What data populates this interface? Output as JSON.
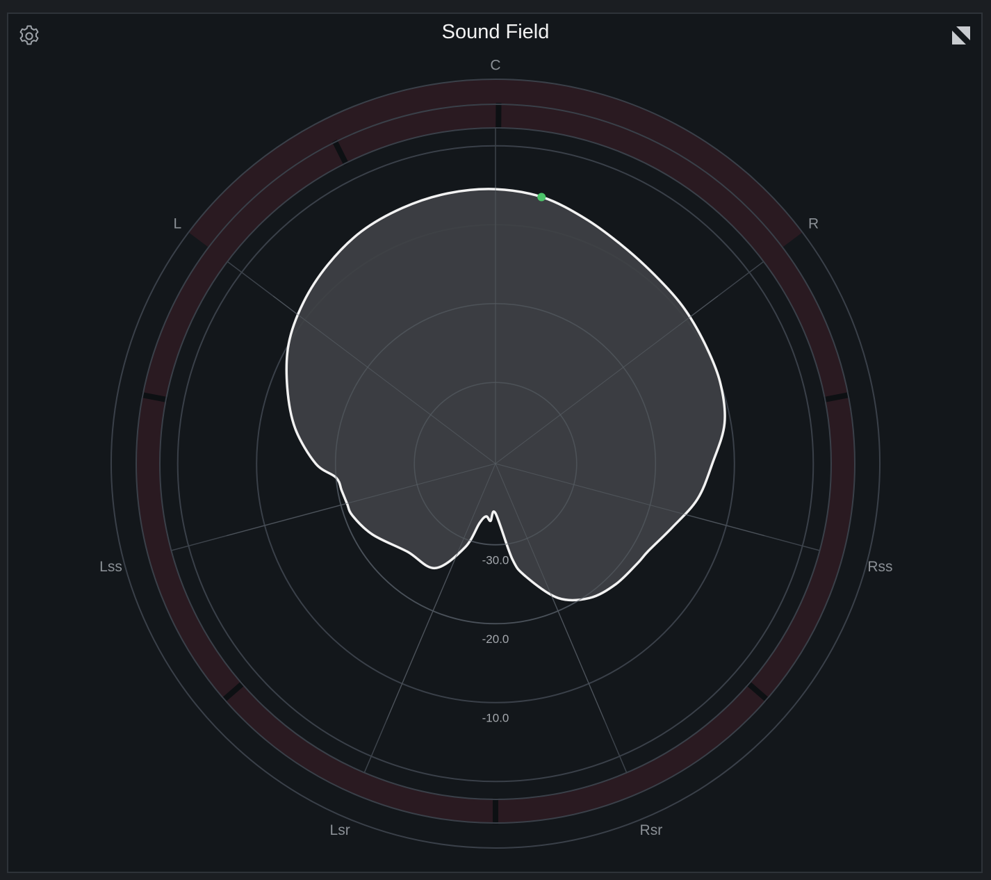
{
  "header": {
    "title": "Sound Field",
    "settings_icon": "gear-icon",
    "expand_icon": "expand-icon"
  },
  "colors": {
    "background": "#13171b",
    "ring": "#3a4049",
    "spoke": "#3d434b",
    "meter_fill": "#2a1a21",
    "meter_gap": "#13171b",
    "lobe_fill": "#3f4145",
    "lobe_stroke": "#f2f2f2",
    "channel_label": "#8b9096",
    "scale_label": "#a4a8ad",
    "indicator": "#4cc46a"
  },
  "channels": [
    {
      "name": "C",
      "angle_deg": 0
    },
    {
      "name": "R",
      "angle_deg": 53
    },
    {
      "name": "Rss",
      "angle_deg": 105
    },
    {
      "name": "Rsr",
      "angle_deg": 157
    },
    {
      "name": "Lsr",
      "angle_deg": 203
    },
    {
      "name": "Lss",
      "angle_deg": 255
    },
    {
      "name": "L",
      "angle_deg": 307
    }
  ],
  "scale": {
    "unit": "dB",
    "rings": [
      {
        "label": "-30.0",
        "value": -30
      },
      {
        "label": "-20.0",
        "value": -20
      },
      {
        "label": "-10.0",
        "value": -10
      }
    ]
  },
  "indicator": {
    "angle_deg": 9.8,
    "level_db": -6
  },
  "lobe": {
    "points": [
      [
        0,
        -5.5
      ],
      [
        10,
        -6.0
      ],
      [
        20,
        -7.2
      ],
      [
        30,
        -8.3
      ],
      [
        40,
        -9.0
      ],
      [
        50,
        -9.3
      ],
      [
        60,
        -9.7
      ],
      [
        70,
        -10.0
      ],
      [
        80,
        -10.8
      ],
      [
        90,
        -12.8
      ],
      [
        100,
        -14.3
      ],
      [
        110,
        -16.5
      ],
      [
        120,
        -18.0
      ],
      [
        125,
        -18.3
      ],
      [
        135,
        -18.7
      ],
      [
        145,
        -19.5
      ],
      [
        155,
        -21.5
      ],
      [
        165,
        -25.5
      ],
      [
        170,
        -28.0
      ],
      [
        180,
        -34.0
      ],
      [
        185,
        -33.0
      ],
      [
        190,
        -33.5
      ],
      [
        195,
        -32.5
      ],
      [
        200,
        -29.0
      ],
      [
        210,
        -25.0
      ],
      [
        225,
        -24.5
      ],
      [
        240,
        -22.3
      ],
      [
        250,
        -21.0
      ],
      [
        255,
        -20.8
      ],
      [
        260,
        -20.5
      ],
      [
        265,
        -20.0
      ],
      [
        270,
        -17.5
      ],
      [
        280,
        -14.5
      ],
      [
        290,
        -12.2
      ],
      [
        300,
        -10.0
      ],
      [
        310,
        -8.5
      ],
      [
        320,
        -7.3
      ],
      [
        330,
        -6.3
      ],
      [
        340,
        -5.8
      ],
      [
        350,
        -5.5
      ]
    ]
  }
}
